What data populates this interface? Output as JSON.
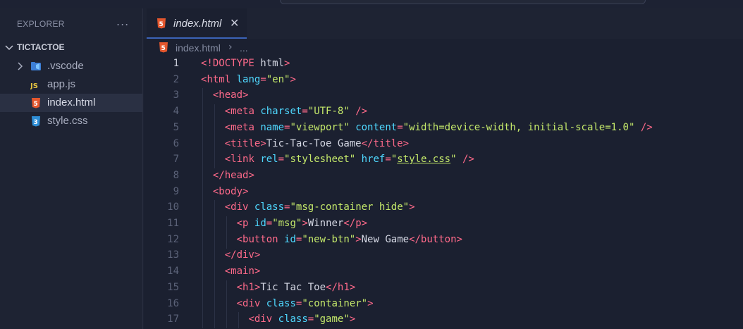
{
  "sidebar": {
    "header": "EXPLORER",
    "more_icon": "...",
    "folder": "TICTACTOE",
    "items": [
      {
        "label": ".vscode",
        "icon": "vscode-folder-icon",
        "type": "folder"
      },
      {
        "label": "app.js",
        "icon": "js-file-icon",
        "type": "file"
      },
      {
        "label": "index.html",
        "icon": "html5-file-icon",
        "type": "file",
        "active": true
      },
      {
        "label": "style.css",
        "icon": "css3-file-icon",
        "type": "file"
      }
    ]
  },
  "editor": {
    "tab_label": "index.html",
    "tab_close": "✕",
    "breadcrumb": {
      "file": "index.html",
      "separator": "›",
      "more": "..."
    },
    "colors": {
      "tag": "#ff6a8a",
      "attribute": "#4fd8ff",
      "string": "#c4e86a",
      "text": "#d5d8e4",
      "html_icon": "#e4572e",
      "css_icon": "#2f8fd8",
      "js_icon": "#e6c440",
      "accent": "#3b63b8"
    },
    "lines": [
      {
        "num": "1",
        "indent": 0,
        "tokens": [
          [
            "p",
            "<!"
          ],
          [
            "tag",
            "DOCTYPE"
          ],
          [
            "text",
            " html"
          ],
          [
            "p",
            ">"
          ]
        ]
      },
      {
        "num": "2",
        "indent": 0,
        "tokens": [
          [
            "p",
            "<"
          ],
          [
            "tag",
            "html"
          ],
          [
            "text",
            " "
          ],
          [
            "attr",
            "lang"
          ],
          [
            "p",
            "="
          ],
          [
            "str",
            "\"en\""
          ],
          [
            "p",
            ">"
          ]
        ]
      },
      {
        "num": "3",
        "indent": 1,
        "tokens": [
          [
            "p",
            "<"
          ],
          [
            "tag",
            "head"
          ],
          [
            "p",
            ">"
          ]
        ]
      },
      {
        "num": "4",
        "indent": 2,
        "tokens": [
          [
            "p",
            "<"
          ],
          [
            "tag",
            "meta"
          ],
          [
            "text",
            " "
          ],
          [
            "attr",
            "charset"
          ],
          [
            "p",
            "="
          ],
          [
            "str",
            "\"UTF-8\""
          ],
          [
            "text",
            " "
          ],
          [
            "p",
            "/>"
          ]
        ]
      },
      {
        "num": "5",
        "indent": 2,
        "tokens": [
          [
            "p",
            "<"
          ],
          [
            "tag",
            "meta"
          ],
          [
            "text",
            " "
          ],
          [
            "attr",
            "name"
          ],
          [
            "p",
            "="
          ],
          [
            "str",
            "\"viewport\""
          ],
          [
            "text",
            " "
          ],
          [
            "attr",
            "content"
          ],
          [
            "p",
            "="
          ],
          [
            "str",
            "\"width=device-width, initial-scale=1.0\""
          ],
          [
            "text",
            " "
          ],
          [
            "p",
            "/>"
          ]
        ]
      },
      {
        "num": "6",
        "indent": 2,
        "tokens": [
          [
            "p",
            "<"
          ],
          [
            "tag",
            "title"
          ],
          [
            "p",
            ">"
          ],
          [
            "text",
            "Tic-Tac-Toe Game"
          ],
          [
            "p",
            "</"
          ],
          [
            "tag",
            "title"
          ],
          [
            "p",
            ">"
          ]
        ]
      },
      {
        "num": "7",
        "indent": 2,
        "tokens": [
          [
            "p",
            "<"
          ],
          [
            "tag",
            "link"
          ],
          [
            "text",
            " "
          ],
          [
            "attr",
            "rel"
          ],
          [
            "p",
            "="
          ],
          [
            "str",
            "\"stylesheet\""
          ],
          [
            "text",
            " "
          ],
          [
            "attr",
            "href"
          ],
          [
            "p",
            "="
          ],
          [
            "str",
            "\""
          ],
          [
            "link",
            "style.css"
          ],
          [
            "str",
            "\""
          ],
          [
            "text",
            " "
          ],
          [
            "p",
            "/>"
          ]
        ]
      },
      {
        "num": "8",
        "indent": 1,
        "tokens": [
          [
            "p",
            "</"
          ],
          [
            "tag",
            "head"
          ],
          [
            "p",
            ">"
          ]
        ]
      },
      {
        "num": "9",
        "indent": 1,
        "tokens": [
          [
            "p",
            "<"
          ],
          [
            "tag",
            "body"
          ],
          [
            "p",
            ">"
          ]
        ]
      },
      {
        "num": "10",
        "indent": 2,
        "tokens": [
          [
            "p",
            "<"
          ],
          [
            "tag",
            "div"
          ],
          [
            "text",
            " "
          ],
          [
            "attr",
            "class"
          ],
          [
            "p",
            "="
          ],
          [
            "str",
            "\"msg-container hide\""
          ],
          [
            "p",
            ">"
          ]
        ]
      },
      {
        "num": "11",
        "indent": 3,
        "tokens": [
          [
            "p",
            "<"
          ],
          [
            "tag",
            "p"
          ],
          [
            "text",
            " "
          ],
          [
            "attr",
            "id"
          ],
          [
            "p",
            "="
          ],
          [
            "str",
            "\"msg\""
          ],
          [
            "p",
            ">"
          ],
          [
            "text",
            "Winner"
          ],
          [
            "p",
            "</"
          ],
          [
            "tag",
            "p"
          ],
          [
            "p",
            ">"
          ]
        ]
      },
      {
        "num": "12",
        "indent": 3,
        "tokens": [
          [
            "p",
            "<"
          ],
          [
            "tag",
            "button"
          ],
          [
            "text",
            " "
          ],
          [
            "attr",
            "id"
          ],
          [
            "p",
            "="
          ],
          [
            "str",
            "\"new-btn\""
          ],
          [
            "p",
            ">"
          ],
          [
            "text",
            "New Game"
          ],
          [
            "p",
            "</"
          ],
          [
            "tag",
            "button"
          ],
          [
            "p",
            ">"
          ]
        ]
      },
      {
        "num": "13",
        "indent": 2,
        "tokens": [
          [
            "p",
            "</"
          ],
          [
            "tag",
            "div"
          ],
          [
            "p",
            ">"
          ]
        ]
      },
      {
        "num": "14",
        "indent": 2,
        "tokens": [
          [
            "p",
            "<"
          ],
          [
            "tag",
            "main"
          ],
          [
            "p",
            ">"
          ]
        ]
      },
      {
        "num": "15",
        "indent": 3,
        "tokens": [
          [
            "p",
            "<"
          ],
          [
            "tag",
            "h1"
          ],
          [
            "p",
            ">"
          ],
          [
            "text",
            "Tic Tac Toe"
          ],
          [
            "p",
            "</"
          ],
          [
            "tag",
            "h1"
          ],
          [
            "p",
            ">"
          ]
        ]
      },
      {
        "num": "16",
        "indent": 3,
        "tokens": [
          [
            "p",
            "<"
          ],
          [
            "tag",
            "div"
          ],
          [
            "text",
            " "
          ],
          [
            "attr",
            "class"
          ],
          [
            "p",
            "="
          ],
          [
            "str",
            "\"container\""
          ],
          [
            "p",
            ">"
          ]
        ]
      },
      {
        "num": "17",
        "indent": 4,
        "tokens": [
          [
            "p",
            "<"
          ],
          [
            "tag",
            "div"
          ],
          [
            "text",
            " "
          ],
          [
            "attr",
            "class"
          ],
          [
            "p",
            "="
          ],
          [
            "str",
            "\"game\""
          ],
          [
            "p",
            ">"
          ]
        ]
      }
    ]
  }
}
